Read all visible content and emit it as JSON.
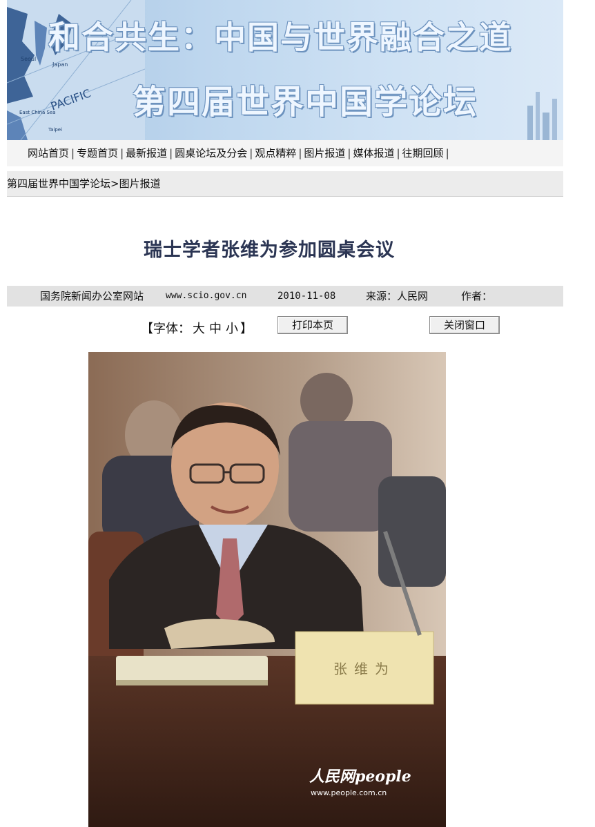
{
  "banner": {
    "title_line1": "和合共生：中国与世界融合之道",
    "title_line2": "第四届世界中国学论坛",
    "map_labels": [
      "Seoul",
      "Japan",
      "PACIFIC",
      "East China Sea",
      "Taipei"
    ]
  },
  "nav": {
    "items": [
      "网站首页",
      "专题首页",
      "最新报道",
      "圆桌论坛及分会",
      "观点精粹",
      "图片报道",
      "媒体报道",
      "往期回顾"
    ],
    "separator": "|"
  },
  "breadcrumb": "第四届世界中国学论坛>图片报道",
  "article": {
    "title": "瑞士学者张维为参加圆桌会议",
    "meta": {
      "site": "国务院新闻办公室网站",
      "url": "www.scio.gov.cn",
      "date": "2010-11-08",
      "source": "来源：人民网",
      "author": "作者："
    }
  },
  "tools": {
    "font_open": "【字体：",
    "font_large": "大",
    "font_medium": "中",
    "font_small": "小",
    "font_close": "】",
    "print_label": "打印本页",
    "close_label": "关闭窗口"
  },
  "photo": {
    "nameplate": "张维为",
    "watermark_logo": "人民网people",
    "watermark_url": "www.people.com.cn"
  },
  "colors": {
    "banner_bg": "#bdd6ee",
    "title_color": "#2b3553",
    "meta_bar": "#e2e2e2"
  }
}
